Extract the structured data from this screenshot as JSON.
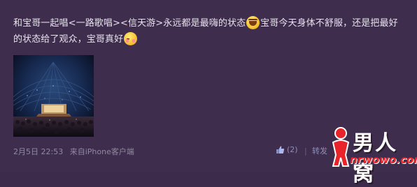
{
  "post": {
    "text_part1": "和宝哥一起唱<一路歌唱><信天游>永远都是最嗨的状态",
    "text_part2": "宝哥今天身体不舒服，还是把最好的状态给了观众，宝哥真好",
    "emoji_1": "laugh-emoji-icon",
    "emoji_2": "shy-emoji-icon",
    "photo": "concert-photo"
  },
  "meta": {
    "date": "2月5日 22:53",
    "source": "来自iPhone客户端"
  },
  "actions": {
    "like_count": "(2)",
    "separator": "|",
    "forward_label": "转发"
  },
  "watermark": {
    "text": "男人窝",
    "url": "nrwowo.com",
    "logo_icon": "person-logo-icon"
  },
  "colors": {
    "background": "#3f2d4d",
    "text": "#e6e2ee",
    "meta": "#8f8aa0",
    "link": "#8d8fb6",
    "watermark_red": "#e8242a"
  }
}
